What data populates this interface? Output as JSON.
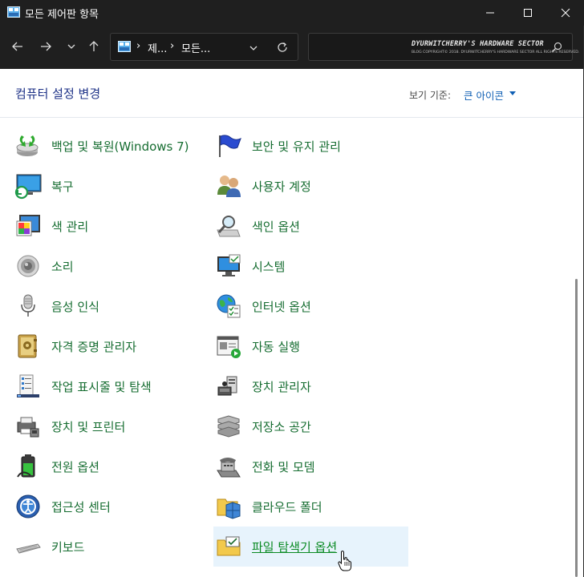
{
  "window": {
    "title": "모든 제어판 항목"
  },
  "address": {
    "crumbs": [
      "제...",
      "모든..."
    ],
    "separator": "›"
  },
  "search": {
    "watermark_title": "DYURWITCHERRY'S HARDWARE SECTOR",
    "watermark_sub": "BLOG COPYRIGHT© 2018. DYURWITCHERRY'S HARDWARE SECTOR ALL RIGHTS RESERVED."
  },
  "header": {
    "title": "컴퓨터 설정 변경",
    "view_by_label": "보기 기준:",
    "view_by_value": "큰 아이콘"
  },
  "items": {
    "left": [
      {
        "label": "백업 및 복원(Windows 7)",
        "icon": "backup-restore-icon"
      },
      {
        "label": "복구",
        "icon": "recovery-icon"
      },
      {
        "label": "색 관리",
        "icon": "color-management-icon"
      },
      {
        "label": "소리",
        "icon": "sound-icon"
      },
      {
        "label": "음성 인식",
        "icon": "microphone-icon"
      },
      {
        "label": "자격 증명 관리자",
        "icon": "credential-manager-icon"
      },
      {
        "label": "작업 표시줄 및 탐색",
        "icon": "taskbar-icon"
      },
      {
        "label": "장치 및 프린터",
        "icon": "printer-icon"
      },
      {
        "label": "전원 옵션",
        "icon": "power-options-icon"
      },
      {
        "label": "접근성 센터",
        "icon": "ease-of-access-icon"
      },
      {
        "label": "키보드",
        "icon": "keyboard-icon"
      }
    ],
    "right": [
      {
        "label": "보안 및 유지 관리",
        "icon": "security-flag-icon"
      },
      {
        "label": "사용자 계정",
        "icon": "user-accounts-icon"
      },
      {
        "label": "색인 옵션",
        "icon": "indexing-options-icon"
      },
      {
        "label": "시스템",
        "icon": "system-icon"
      },
      {
        "label": "인터넷 옵션",
        "icon": "internet-options-icon"
      },
      {
        "label": "자동 실행",
        "icon": "autoplay-icon"
      },
      {
        "label": "장치 관리자",
        "icon": "device-manager-icon"
      },
      {
        "label": "저장소 공간",
        "icon": "storage-spaces-icon"
      },
      {
        "label": "전화 및 모뎀",
        "icon": "phone-modem-icon"
      },
      {
        "label": "클라우드 폴더",
        "icon": "cloud-folder-icon"
      },
      {
        "label": "파일 탐색기 옵션",
        "icon": "file-explorer-options-icon"
      }
    ]
  },
  "colors": {
    "link_green": "#166d31",
    "header_blue": "#1e3287",
    "view_blue": "#0f5fb4",
    "hover_bg": "#e7f3fc"
  }
}
